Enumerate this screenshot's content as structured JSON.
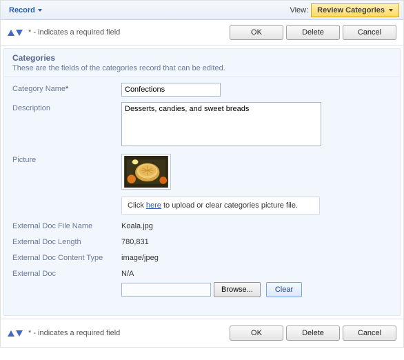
{
  "toolbar": {
    "record_label": "Record",
    "view_label": "View:",
    "view_value": "Review Categories"
  },
  "actions": {
    "required_note": "* - indicates a required field",
    "ok": "OK",
    "delete": "Delete",
    "cancel": "Cancel"
  },
  "section": {
    "title": "Categories",
    "subtitle": "These are the fields of the categories record that can be edited."
  },
  "form": {
    "category_name": {
      "label": "Category Name",
      "value": "Confections"
    },
    "description": {
      "label": "Description",
      "value": "Desserts, candies, and sweet breads"
    },
    "picture": {
      "label": "Picture",
      "upload_prefix": "Click ",
      "upload_link": "here",
      "upload_suffix": " to upload or clear categories picture file."
    },
    "ext_file_name": {
      "label": "External Doc File Name",
      "value": "Koala.jpg"
    },
    "ext_length": {
      "label": "External Doc Length",
      "value": "780,831"
    },
    "ext_content_type": {
      "label": "External Doc Content Type",
      "value": "image/jpeg"
    },
    "ext_doc": {
      "label": "External Doc",
      "value": "N/A",
      "browse": "Browse...",
      "clear": "Clear"
    }
  }
}
